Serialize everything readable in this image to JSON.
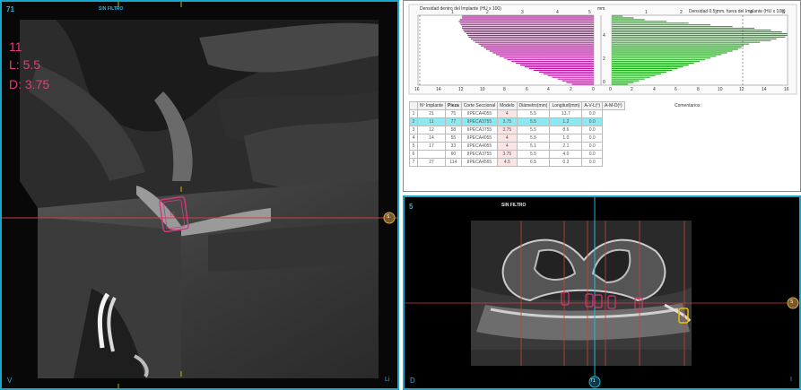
{
  "left_view": {
    "corner_tl": "71",
    "filter_label": "SIN FILTRO",
    "tooth_number": "11",
    "length_text": "L: 5.5",
    "diameter_text": "D: 3.75",
    "implant_label": "11",
    "corner_bl": "V",
    "corner_br": "Li",
    "marker_right": "S",
    "marker_bottom": "",
    "accent_color": "#e0407a"
  },
  "chart_panel": {
    "inside_title": "Densidad dentro del Implante (HU x 100)",
    "outside_title": "Densidad 0.5 mm. fuera del Implante (HU x 100)",
    "mm_label": "mm",
    "inside_top_ticks": [
      "1",
      "2",
      "3",
      "4",
      "5"
    ],
    "inside_bottom_ticks": [
      "16",
      "14",
      "12",
      "10",
      "8",
      "6",
      "4",
      "2",
      "0"
    ],
    "outside_top_ticks": [
      "1",
      "2",
      "3",
      "4",
      "5"
    ],
    "outside_bottom_ticks": [
      "0",
      "2",
      "4",
      "6",
      "8",
      "10",
      "12",
      "14",
      "16"
    ],
    "mm_ticks": [
      "4",
      "2",
      "0"
    ],
    "comments_label": "Comentarios:",
    "table": {
      "headers": [
        "Nº Implante",
        "Pieza",
        "Corte Seccional",
        "Modelo",
        "Diámetro(mm)",
        "Longitud(mm)",
        "A-V-L(º)",
        "A-M-D(º)"
      ],
      "rows": [
        [
          "1",
          "21",
          "75",
          "IIPECA4055",
          "4",
          "5.5",
          "13.7",
          "0.0"
        ],
        [
          "2",
          "11",
          "77",
          "IIPECA3755",
          "3.75",
          "5.5",
          "1.2",
          "0.0"
        ],
        [
          "3",
          "12",
          "58",
          "IIPECA3755",
          "3.75",
          "5.5",
          "8.6",
          "0.0"
        ],
        [
          "4",
          "14",
          "55",
          "IIPECA4055",
          "4",
          "5.5",
          "1.0",
          "0.0"
        ],
        [
          "5",
          "17",
          "33",
          "IIPECA4055",
          "4",
          "5.1",
          "2.1",
          "0.0"
        ],
        [
          "6",
          "",
          "60",
          "IIPECA3755",
          "3.75",
          "5.5",
          "4.0",
          "0.0"
        ],
        [
          "7",
          "27",
          "114",
          "IIPECA4565",
          "4.5",
          "6.5",
          "0.2",
          "0.0"
        ]
      ],
      "selected_row": 1
    },
    "colors": {
      "inside": "#b5139e",
      "outside": "#1ea81a",
      "selected": "#8ee8f0"
    }
  },
  "chart_data": [
    {
      "type": "bar",
      "title": "Densidad dentro del Implante (HU x 100)",
      "orientation": "horizontal",
      "xlim": [
        0,
        16
      ],
      "ylim": [
        0,
        5.5
      ],
      "values": [
        12,
        12,
        12.2,
        12.3,
        12.2,
        12.1,
        12,
        12,
        11.9,
        11.8,
        11.6,
        11.5,
        11.4,
        11.2,
        11,
        10.8,
        10.5,
        10.3,
        10,
        9.8,
        9.5,
        9.2,
        8.9,
        8.6,
        8.2,
        7.9,
        7.5,
        7.1,
        6.7,
        6.3,
        5.9,
        5.5,
        5,
        4.6,
        4.2,
        3.8,
        3.3,
        2.9,
        2.5,
        2
      ]
    },
    {
      "type": "bar",
      "title": "Densidad 0.5 mm. fuera del Implante (HU x 100)",
      "orientation": "horizontal",
      "xlim": [
        0,
        16
      ],
      "ylim": [
        0,
        5.5
      ],
      "values": [
        1,
        2,
        3,
        5,
        7,
        9,
        11,
        13,
        14.5,
        15.5,
        16,
        16,
        15.8,
        15,
        14.5,
        13.5,
        12.5,
        12,
        11.8,
        11.5,
        11,
        10.5,
        10,
        9.5,
        9,
        8.5,
        8,
        7.5,
        7,
        6.5,
        6,
        5.5,
        5,
        4.5,
        4,
        3.5,
        3,
        2.5,
        2,
        1.5
      ]
    }
  ],
  "axial_view": {
    "corner_tl": "5",
    "filter_label": "SIN FILTRO",
    "corner_bl": "D",
    "corner_br": "I",
    "marker_bottom": "71",
    "marker_right": "S"
  }
}
